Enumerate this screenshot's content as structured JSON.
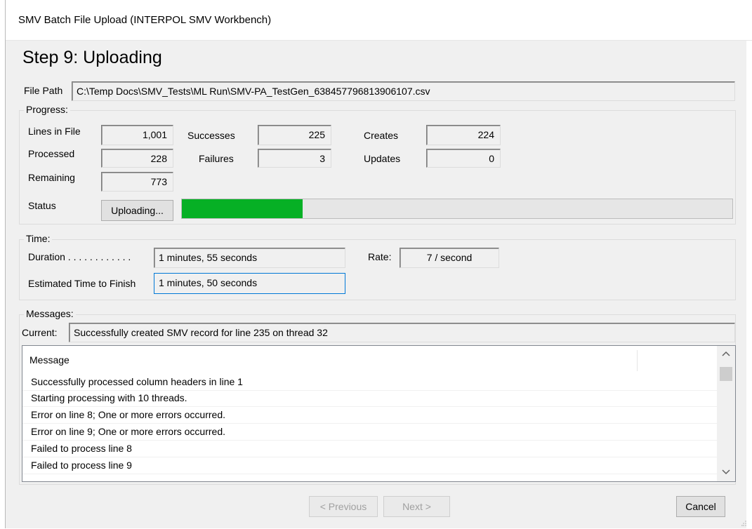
{
  "window": {
    "title": "SMV Batch File Upload (INTERPOL SMV Workbench)"
  },
  "step": {
    "title": "Step 9:  Uploading"
  },
  "file": {
    "label": "File Path",
    "value": "C:\\Temp Docs\\SMV_Tests\\ML Run\\SMV-PA_TestGen_638457796813906107.csv"
  },
  "progress": {
    "group_label": "Progress:",
    "lines_label": "Lines in File",
    "lines_value": "1,001",
    "processed_label": "Processed",
    "processed_value": "228",
    "remaining_label": "Remaining",
    "remaining_value": "773",
    "successes_label": "Successes",
    "successes_value": "225",
    "failures_label": "Failures",
    "failures_value": "3",
    "creates_label": "Creates",
    "creates_value": "224",
    "updates_label": "Updates",
    "updates_value": "0",
    "status_label": "Status",
    "status_button": "Uploading...",
    "bar_fraction": 0.22
  },
  "time": {
    "group_label": "Time:",
    "duration_label": "Duration . . . . . . . . . . . .",
    "duration_value": "1 minutes, 55 seconds",
    "rate_label": "Rate:",
    "rate_value": "7 / second",
    "eta_label": "Estimated Time to Finish",
    "eta_value": "1 minutes, 50 seconds"
  },
  "messages": {
    "group_label": "Messages:",
    "current_label": "Current:",
    "current_value": "Successfully created SMV record for line 235 on thread 32",
    "column_header": "Message",
    "rows": [
      "Successfully processed column headers in line 1",
      "Starting processing with 10 threads.",
      "Error on line 8; One or more errors occurred.",
      "Error on line 9; One or more errors occurred.",
      "Failed to process line 8",
      "Failed to process line 9"
    ]
  },
  "buttons": {
    "previous": "< Previous",
    "next": "Next >",
    "cancel": "Cancel"
  },
  "colors": {
    "progress_fill": "#06b025",
    "window_bg": "#f0f0f0",
    "focus_border": "#0078d7"
  }
}
